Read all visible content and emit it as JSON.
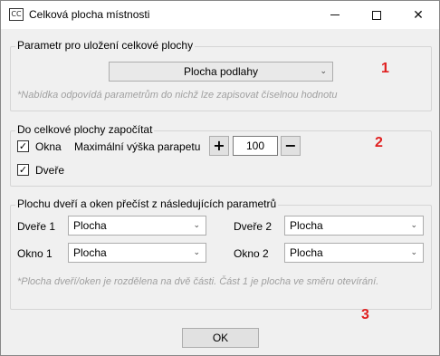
{
  "window": {
    "title": "Celková plocha místnosti",
    "icon_text": "CC",
    "close_glyph": "✕"
  },
  "group1": {
    "title": "Parametr pro uložení celkové plochy",
    "selected": "Plocha podlahy",
    "hint": "*Nabídka odpovídá parametrům do nichž lze zapisovat číselnou hodnotu",
    "marker": "1"
  },
  "group2": {
    "title": "Do celkové plochy započítat",
    "okna_label": "Okna",
    "okna_checked": true,
    "dvere_label": "Dveře",
    "dvere_checked": true,
    "max_label": "Maximální výška parapetu",
    "plus": "+",
    "value": "100",
    "minus": "−",
    "marker": "2",
    "check_glyph": "✓"
  },
  "group3": {
    "title": "Plochu dveří a oken přečíst z následujících parametrů",
    "dvere1_label": "Dveře 1",
    "dvere1_value": "Plocha",
    "okno1_label": "Okno 1",
    "okno1_value": "Plocha",
    "dvere2_label": "Dveře 2",
    "dvere2_value": "Plocha",
    "okno2_label": "Okno 2",
    "okno2_value": "Plocha",
    "hint": "*Plocha dveří/oken je rozdělena na dvě části. Část 1 je plocha ve směru otevírání.",
    "marker": "3"
  },
  "footer": {
    "ok_label": "OK"
  },
  "icons": {
    "dropdown": "chevron-down-icon",
    "arrow_glyph": "⌄"
  },
  "colors": {
    "marker": "#e02020",
    "hint": "#a0a0a0"
  }
}
